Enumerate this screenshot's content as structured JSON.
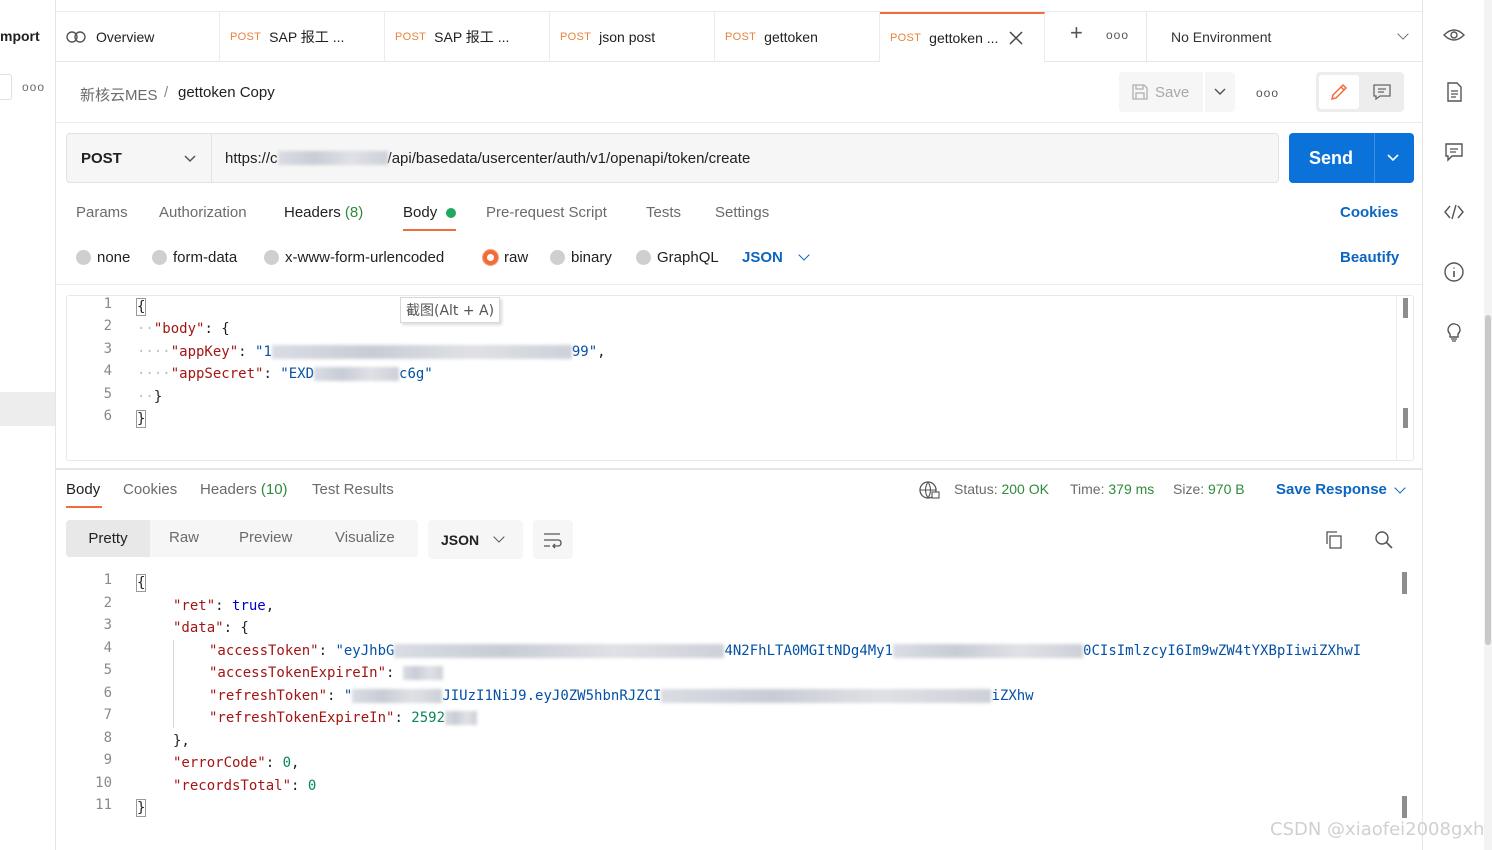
{
  "left_sidebar": {
    "import_label": "mport",
    "more_label": "ooo"
  },
  "tabs": {
    "overview_label": "Overview",
    "items": [
      {
        "method": "POST",
        "label": "SAP 报工 ..."
      },
      {
        "method": "POST",
        "label": "SAP 报工 ..."
      },
      {
        "method": "POST",
        "label": "json post"
      },
      {
        "method": "POST",
        "label": "gettoken"
      },
      {
        "method": "POST",
        "label": "gettoken ..."
      }
    ],
    "new_tab": "+",
    "more": "ooo"
  },
  "environment": {
    "label": "No Environment"
  },
  "breadcrumb": {
    "parent": "新核云MES",
    "separator": "/",
    "current": "gettoken Copy"
  },
  "toolbar": {
    "save_label": "Save",
    "more": "ooo"
  },
  "request": {
    "method": "POST",
    "url_prefix": "https://c",
    "url_suffix": "/api/basedata/usercenter/auth/v1/openapi/token/create",
    "send_label": "Send"
  },
  "request_tabs": {
    "params": "Params",
    "authorization": "Authorization",
    "headers": "Headers",
    "headers_count": "(8)",
    "body": "Body",
    "pre_request": "Pre-request Script",
    "tests": "Tests",
    "settings": "Settings",
    "cookies": "Cookies"
  },
  "body_types": {
    "none": "none",
    "form_data": "form-data",
    "urlencoded": "x-www-form-urlencoded",
    "raw": "raw",
    "binary": "binary",
    "graphql": "GraphQL",
    "selected": "raw",
    "language": "JSON",
    "beautify": "Beautify"
  },
  "request_body": {
    "open_brace": "{",
    "body_key": "\"body\"",
    "app_key_key": "\"appKey\"",
    "app_key_start": "\"1",
    "app_key_end": "99\"",
    "app_secret_key": "\"appSecret\"",
    "app_secret_start": "\"EXD",
    "app_secret_end": "c6g\"",
    "close_inner": "}",
    "close_brace": "}"
  },
  "tooltip": "截图(Alt + A)",
  "response_tabs": {
    "body": "Body",
    "cookies": "Cookies",
    "headers": "Headers",
    "headers_count": "(10)",
    "test_results": "Test Results"
  },
  "response_status": {
    "status_label": "Status:",
    "status_value": "200 OK",
    "time_label": "Time:",
    "time_value": "379 ms",
    "size_label": "Size:",
    "size_value": "970 B",
    "save_response": "Save Response"
  },
  "response_view": {
    "pretty": "Pretty",
    "raw": "Raw",
    "preview": "Preview",
    "visualize": "Visualize",
    "format": "JSON"
  },
  "response_body": {
    "ret_key": "\"ret\"",
    "ret_value": "true",
    "data_key": "\"data\"",
    "access_token_key": "\"accessToken\"",
    "access_token_start": "\"eyJhbG",
    "access_token_mid1": "4N2FhLTA0MGItNDg4My1",
    "access_token_mid2": "0CIsImlzcyI6Im9wZW4tYXBpIiwiZXhwI",
    "access_expire_key": "\"accessTokenExpireIn\"",
    "refresh_token_key": "\"refreshToken\"",
    "refresh_token_start": "\"",
    "refresh_token_mid": "JIUzI1NiJ9.eyJ0ZW5hbnRJZCI",
    "refresh_token_end": "iZXhw",
    "refresh_expire_key": "\"refreshTokenExpireIn\"",
    "refresh_expire_value": "2592",
    "error_code_key": "\"errorCode\"",
    "error_code_value": "0",
    "records_total_key": "\"recordsTotal\"",
    "records_total_value": "0"
  },
  "watermark": "CSDN @xiaofei2008gxh",
  "colors": {
    "accent_orange": "#f26b3a",
    "send_blue": "#0b72d9",
    "link_blue": "#0b65c2",
    "status_green": "#2e8b3d",
    "method_orange": "#e8833a"
  }
}
